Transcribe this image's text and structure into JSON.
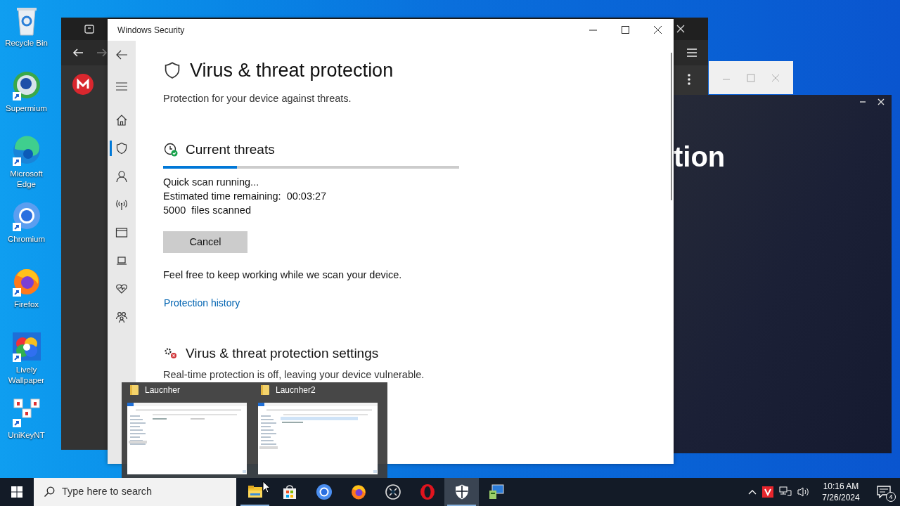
{
  "desktop_icons": [
    {
      "kind": "recycle",
      "label": "Recycle Bin"
    },
    {
      "kind": "globe",
      "label": "Supermium"
    },
    {
      "kind": "swirl",
      "label": "Microsoft Edge"
    },
    {
      "kind": "ring",
      "label": "Chromium"
    },
    {
      "kind": "fox",
      "label": "Firefox"
    },
    {
      "kind": "colors",
      "label": "Lively Wallpaper"
    },
    {
      "kind": "keys",
      "label": "UniKeyNT"
    }
  ],
  "banner_window": {
    "text": "tion"
  },
  "security_window": {
    "title": "Windows Security",
    "nav": [
      {
        "kind": "home",
        "selected": false
      },
      {
        "kind": "shield",
        "selected": true
      },
      {
        "kind": "person",
        "selected": false
      },
      {
        "kind": "antenna",
        "selected": false
      },
      {
        "kind": "window",
        "selected": false
      },
      {
        "kind": "laptop",
        "selected": false
      },
      {
        "kind": "heart",
        "selected": false
      },
      {
        "kind": "family",
        "selected": false
      }
    ],
    "heading": "Virus & threat protection",
    "subtitle": "Protection for your device against threats.",
    "current_threats": {
      "title": "Current threats",
      "scan": {
        "level": 0.25
      },
      "lines": [
        "Quick scan running...",
        "Estimated time remaining:  00:03:27",
        "5000  files scanned"
      ],
      "cancel_button": "Cancel",
      "note": "Feel free to keep working while we scan your device.",
      "link": "Protection history"
    },
    "settings": {
      "title": "Virus & threat protection settings",
      "message": "Real-time protection is off, leaving your device vulnerable."
    }
  },
  "taskbar_previews": [
    {
      "title": "Laucnher"
    },
    {
      "title": "Laucnher2"
    }
  ],
  "taskbar": {
    "search_placeholder": "Type here to search",
    "apps": [
      {
        "kind": "folder",
        "running": true,
        "selected": false
      },
      {
        "kind": "bag",
        "running": false,
        "selected": false
      },
      {
        "kind": "ring",
        "running": false,
        "selected": false
      },
      {
        "kind": "fox",
        "running": false,
        "selected": false
      },
      {
        "kind": "cross",
        "running": false,
        "selected": false
      },
      {
        "kind": "oval",
        "running": false,
        "selected": false
      },
      {
        "kind": "shield",
        "running": true,
        "selected": true
      },
      {
        "kind": "computer",
        "running": false,
        "selected": false
      }
    ],
    "time": "10:16 AM",
    "date": "7/26/2024",
    "notification_count": "4"
  }
}
